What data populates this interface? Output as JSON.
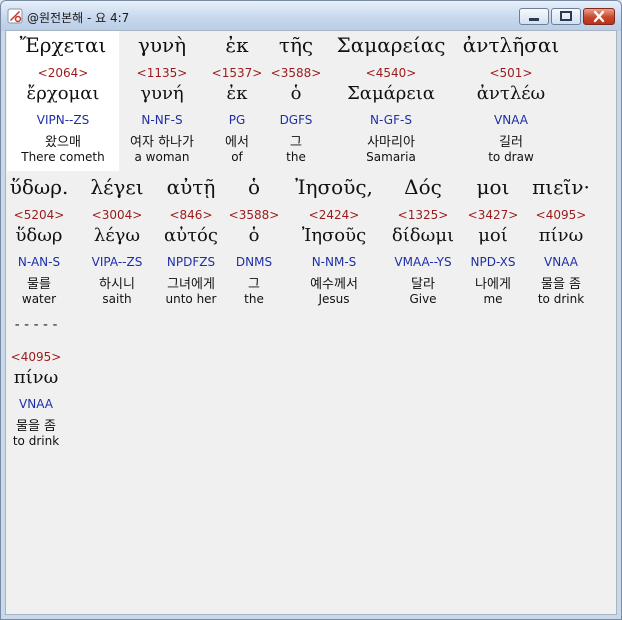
{
  "window": {
    "title": "@원전본해 - 요 4:7",
    "controls": {
      "minimize_icon": "minimize-icon",
      "maximize_icon": "maximize-icon",
      "close_icon": "close-icon"
    }
  },
  "rows": [
    {
      "words": [
        {
          "greek": "Ἔρχεται",
          "strong": "<2064>",
          "lemma": "ἔρχομαι",
          "morph": "VIPN--ZS",
          "korean": "왔으매",
          "english": "There cometh"
        },
        {
          "greek": "γυνὴ",
          "strong": "<1135>",
          "lemma": "γυνή",
          "morph": "N-NF-S",
          "korean": "여자 하나가",
          "english": "a woman"
        },
        {
          "greek": "ἐκ",
          "strong": "<1537>",
          "lemma": "ἐκ",
          "morph": "PG",
          "korean": "에서",
          "english": "of"
        },
        {
          "greek": "τῆς",
          "strong": "<3588>",
          "lemma": "ὁ",
          "morph": "DGFS",
          "korean": "그",
          "english": "the"
        },
        {
          "greek": "Σαμαρείας",
          "strong": "<4540>",
          "lemma": "Σαμάρεια",
          "morph": "N-GF-S",
          "korean": "사마리아",
          "english": "Samaria"
        },
        {
          "greek": "ἀντλῆσαι",
          "strong": "<501>",
          "lemma": "ἀντλέω",
          "morph": "VNAA",
          "korean": "길러",
          "english": "to draw"
        }
      ]
    },
    {
      "words": [
        {
          "greek": "ὕδωρ.",
          "strong": "<5204>",
          "lemma": "ὕδωρ",
          "morph": "N-AN-S",
          "korean": "물를",
          "english": "water"
        },
        {
          "greek": "λέγει",
          "strong": "<3004>",
          "lemma": "λέγω",
          "morph": "VIPA--ZS",
          "korean": "하시니",
          "english": "saith"
        },
        {
          "greek": "αὐτῇ",
          "strong": "<846>",
          "lemma": "αὐτός",
          "morph": "NPDFZS",
          "korean": "그녀에게",
          "english": "unto her"
        },
        {
          "greek": "ὁ",
          "strong": "<3588>",
          "lemma": "ὁ",
          "morph": "DNMS",
          "korean": "그",
          "english": "the"
        },
        {
          "greek": "Ἰησοῦς,",
          "strong": "<2424>",
          "lemma": "Ἰησοῦς",
          "morph": "N-NM-S",
          "korean": "예수께서",
          "english": "Jesus"
        },
        {
          "greek": "Δός",
          "strong": "<1325>",
          "lemma": "δίδωμι",
          "morph": "VMAA--YS",
          "korean": "달라",
          "english": "Give"
        },
        {
          "greek": "μοι",
          "strong": "<3427>",
          "lemma": "μοί",
          "morph": "NPD-XS",
          "korean": "나에게",
          "english": "me"
        },
        {
          "greek": "πιεῖν·",
          "strong": "<4095>",
          "lemma": "πίνω",
          "morph": "VNAA",
          "korean": "물을 좀",
          "english": "to drink"
        }
      ]
    }
  ],
  "divider": "-----",
  "extra": {
    "strong": "<4095>",
    "lemma": "πίνω",
    "morph": "VNAA",
    "korean": "물을 좀",
    "english": "to drink"
  },
  "colors": {
    "strong": "#9b1b1b",
    "morph": "#1d2fa8",
    "text": "#111111",
    "background": "#f0f0f0",
    "highlight": "#ffffff"
  }
}
